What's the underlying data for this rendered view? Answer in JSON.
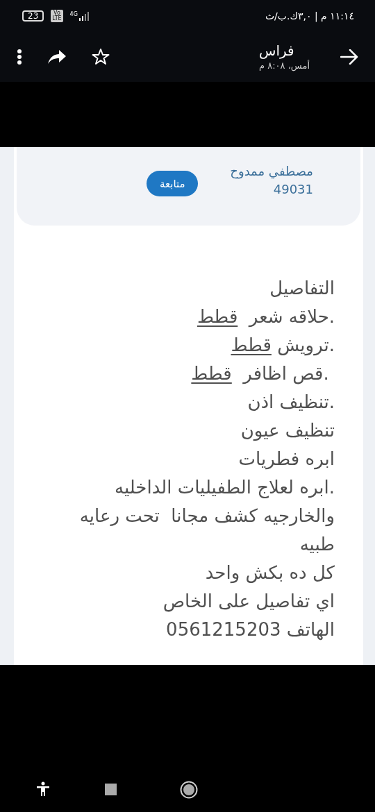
{
  "status_bar": {
    "time": "١١:١٤ م | ٣,٠ك.ب/ث",
    "battery": "23",
    "volte": [
      "Vo",
      "LTE"
    ],
    "network": "4G"
  },
  "header": {
    "title": "فراس",
    "subtitle": "أمس، ٨:٠٨ م"
  },
  "seller": {
    "name": "مصطفي ممدوح",
    "number": "49031",
    "follow_button": "متابعة"
  },
  "details": [
    {
      "text": "التفاصيل"
    },
    {
      "text": ".حلاقه شعر  ",
      "link": "قطط"
    },
    {
      "text": ".ترويش ",
      "link": "قطط"
    },
    {
      "text": " .قص اظافر  ",
      "link": "قطط"
    },
    {
      "text": ".تنظيف اذن"
    },
    {
      "text": "تنظيف عيون"
    },
    {
      "text": "ابره فطريات"
    },
    {
      "text": ".ابره لعلاج الطفيليات الداخليه"
    },
    {
      "text": "والخارجيه كشف مجانا  تحت رعايه"
    },
    {
      "text": "طبيه"
    },
    {
      "text": "كل ده بكش واحد"
    },
    {
      "text": "اي تفاصيل على الخاص"
    },
    {
      "text": "الهاتف 0561215203"
    }
  ]
}
